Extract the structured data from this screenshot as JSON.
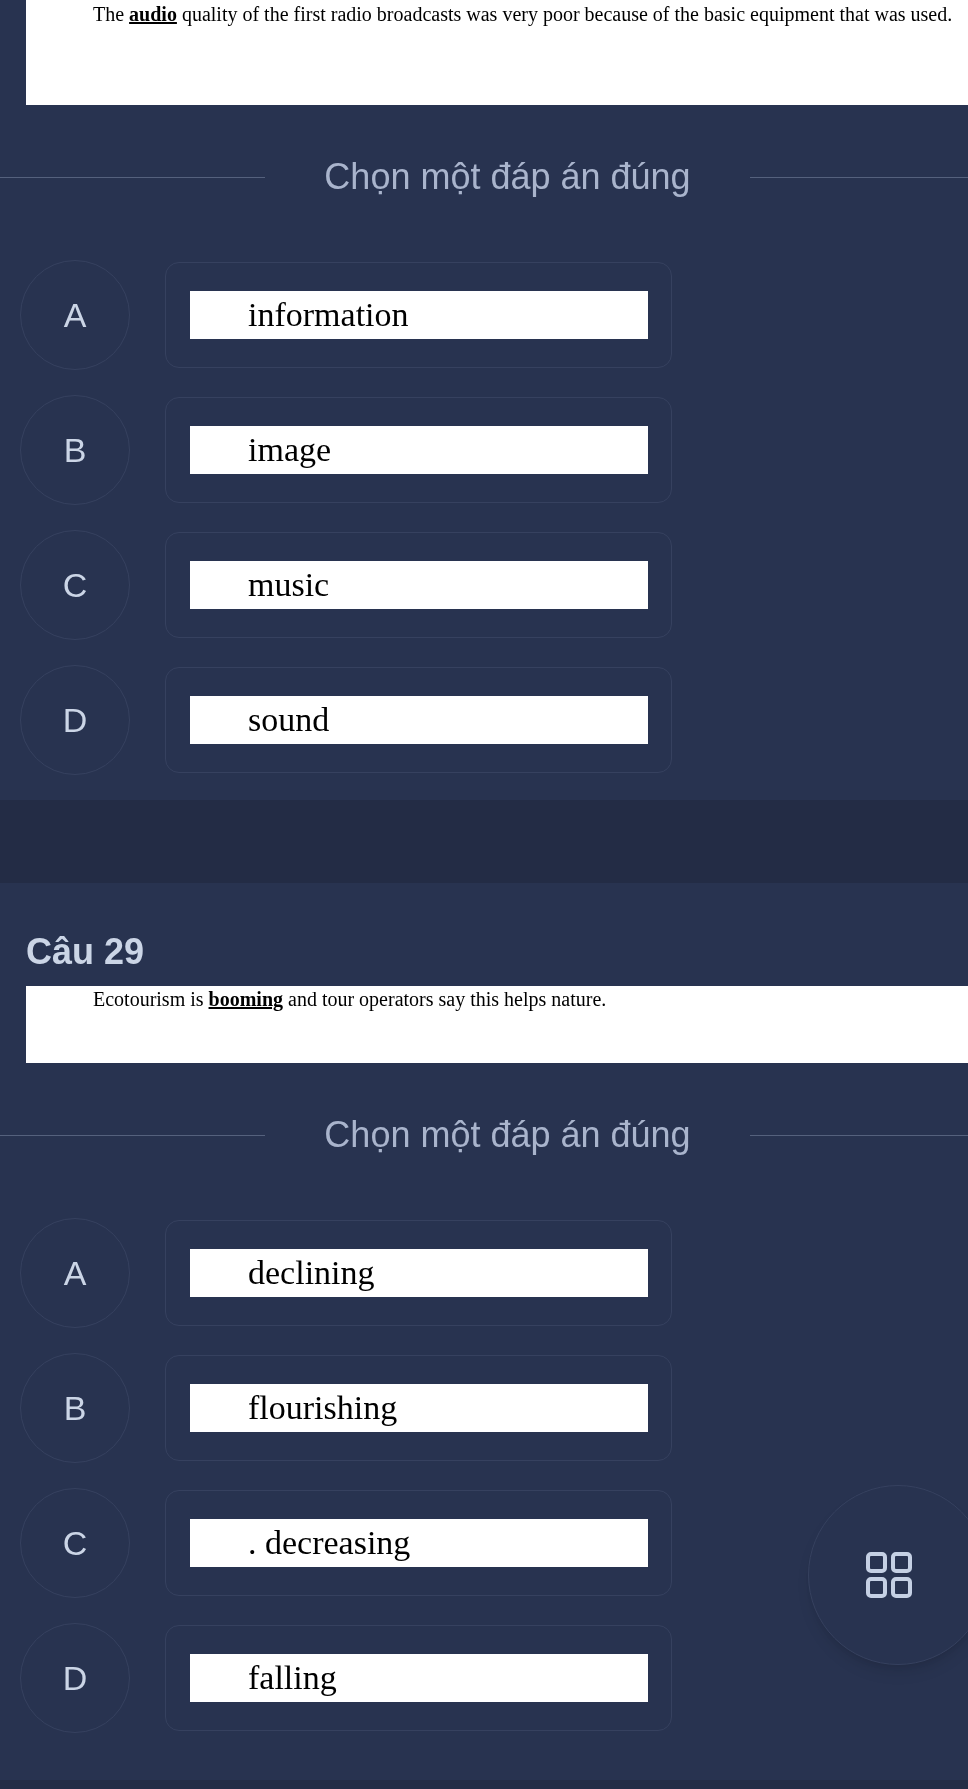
{
  "questions": [
    {
      "stem": "The **audio** quality of the first radio broadcasts was very poor because of the basic equipment that was used.",
      "prompt": "Chọn một đáp án đúng",
      "options": [
        {
          "letter": "A",
          "text": "information"
        },
        {
          "letter": "B",
          "text": "image"
        },
        {
          "letter": "C",
          "text": "music"
        },
        {
          "letter": "D",
          "text": "sound"
        }
      ]
    },
    {
      "title": "Câu 29",
      "stem": "Ecotourism is **booming** and tour operators say this helps nature.",
      "prompt": "Chọn một đáp án đúng",
      "options": [
        {
          "letter": "A",
          "text": "declining"
        },
        {
          "letter": "B",
          "text": "flourishing"
        },
        {
          "letter": "C",
          "text": ". decreasing"
        },
        {
          "letter": "D",
          "text": "falling"
        }
      ]
    }
  ]
}
